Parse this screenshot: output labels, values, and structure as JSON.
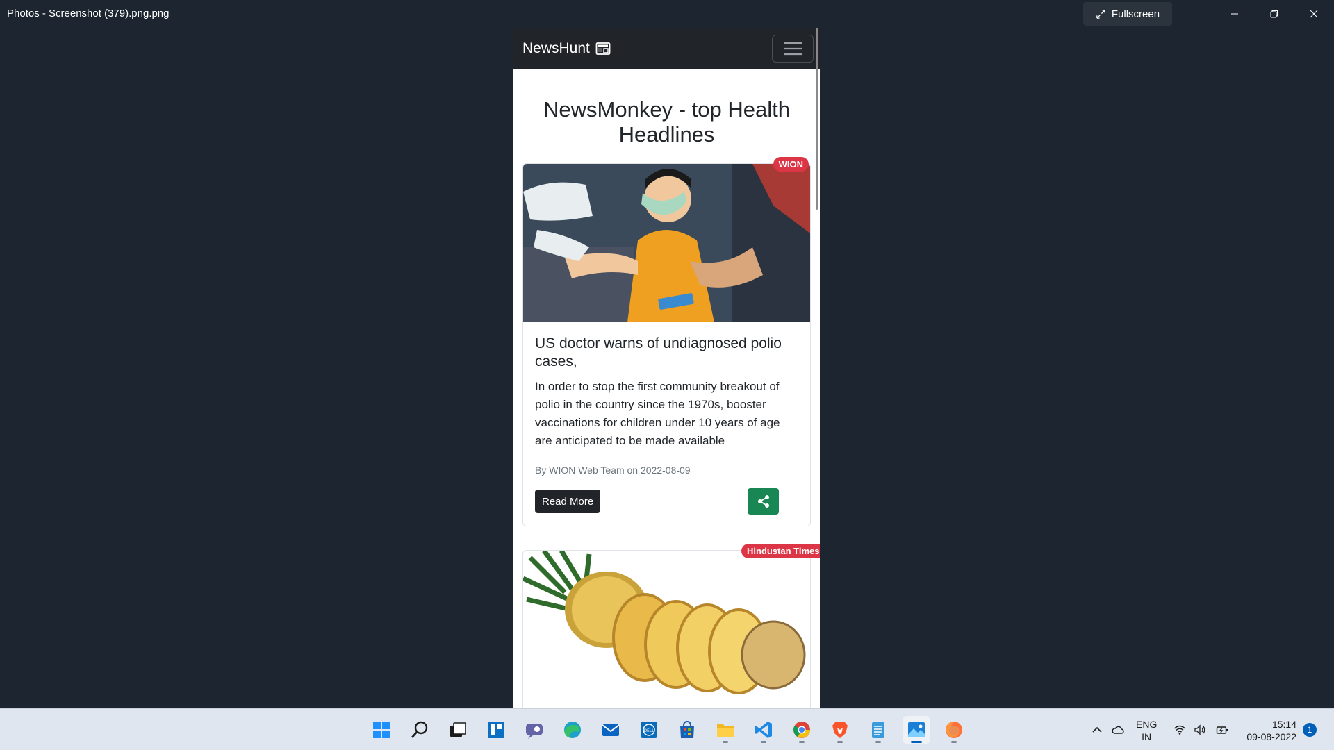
{
  "window": {
    "title": "Photos - Screenshot (379).png.png",
    "fullscreen_label": "Fullscreen"
  },
  "app": {
    "brand": "NewsHunt",
    "heading": "NewsMonkey - top Health Headlines"
  },
  "articles": [
    {
      "source": "WION",
      "title": "US doctor warns of undiagnosed polio cases,",
      "description": "In order to stop the first community breakout of polio in the country since the 1970s, booster vaccinations for children under 10 years of age are anticipated to be made available",
      "meta": "By WION Web Team on 2022-08-09",
      "read_more": "Read More"
    },
    {
      "source": "Hindustan Times"
    }
  ],
  "taskbar": {
    "apps": [
      "start-icon",
      "search-icon",
      "task-view-icon",
      "widgets-icon",
      "teams-chat-icon",
      "edge-icon",
      "mail-icon",
      "dell-icon",
      "store-icon",
      "file-explorer-icon",
      "vscode-icon",
      "chrome-icon",
      "brave-icon",
      "notepad-icon",
      "photos-icon",
      "firefox-icon"
    ],
    "lang_line1": "ENG",
    "lang_line2": "IN",
    "time": "15:14",
    "date": "09-08-2022",
    "notifications": "1"
  },
  "colors": {
    "badge": "#dc3545",
    "share": "#198754",
    "navbar": "#212529",
    "accent": "#005fb8"
  }
}
